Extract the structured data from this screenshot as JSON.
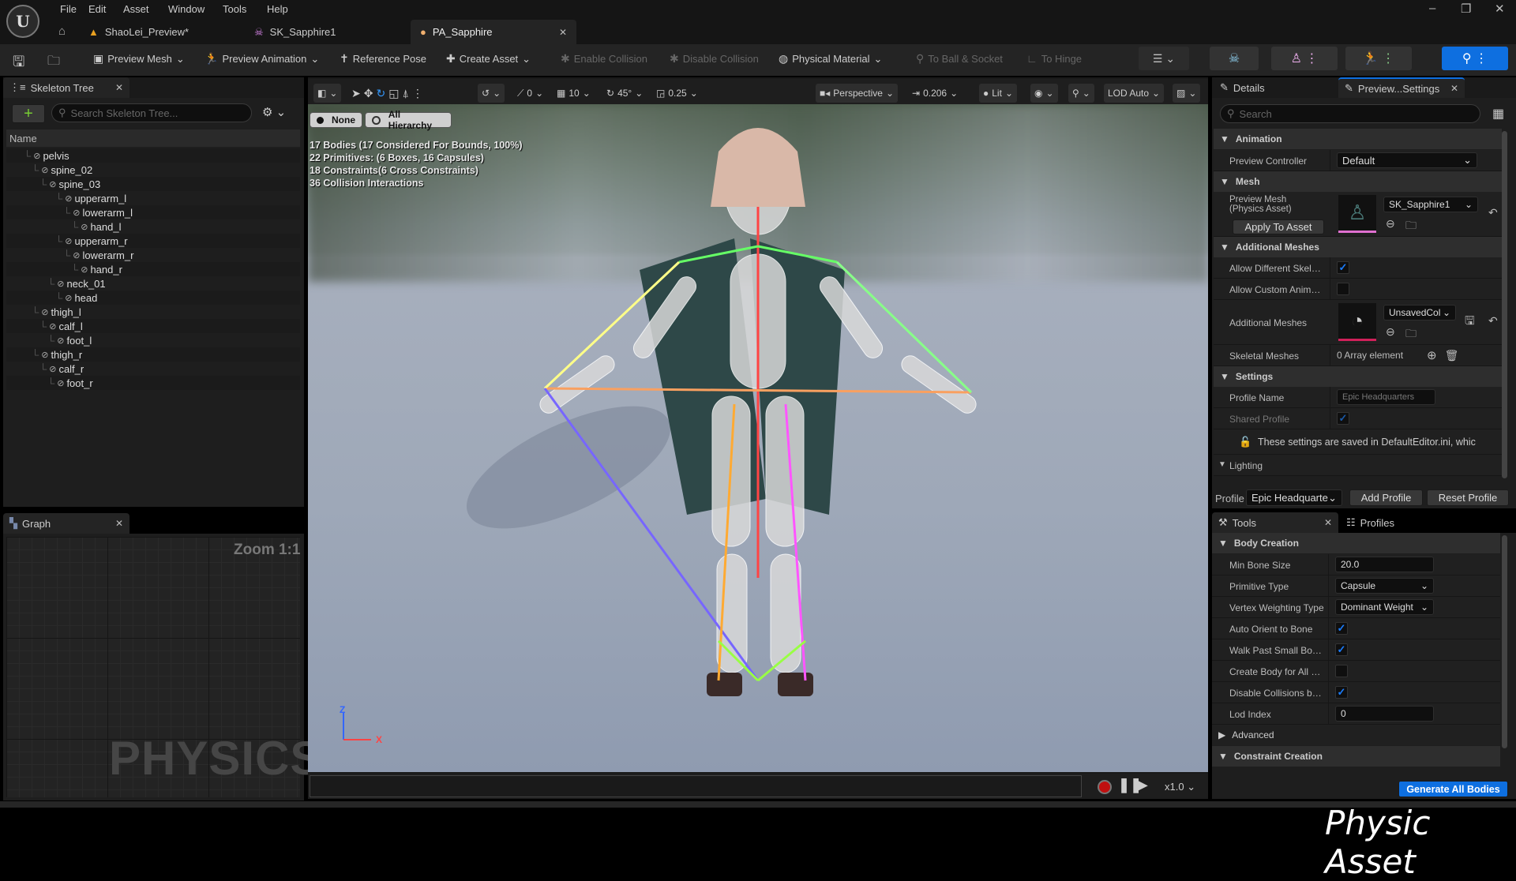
{
  "menu": [
    "File",
    "Edit",
    "Asset",
    "Window",
    "Tools",
    "Help"
  ],
  "doc_tabs": [
    {
      "label": "ShaoLei_Preview*",
      "icon": "level-icon"
    },
    {
      "label": "SK_Sapphire1",
      "icon": "skeleton-icon"
    },
    {
      "label": "PA_Sapphire",
      "icon": "physics-asset-icon",
      "active": true
    }
  ],
  "toolbar": {
    "preview_mesh": "Preview Mesh",
    "preview_animation": "Preview Animation",
    "reference_pose": "Reference Pose",
    "create_asset": "Create Asset",
    "enable_collision": "Enable Collision",
    "disable_collision": "Disable Collision",
    "physical_material": "Physical Material",
    "to_ball_socket": "To Ball & Socket",
    "to_hinge": "To Hinge"
  },
  "skeleton_tree": {
    "title": "Skeleton Tree",
    "search_placeholder": "Search Skeleton Tree...",
    "column": "Name",
    "bones": [
      {
        "name": "pelvis",
        "depth": 0
      },
      {
        "name": "spine_02",
        "depth": 1
      },
      {
        "name": "spine_03",
        "depth": 2
      },
      {
        "name": "upperarm_l",
        "depth": 4
      },
      {
        "name": "lowerarm_l",
        "depth": 5
      },
      {
        "name": "hand_l",
        "depth": 6
      },
      {
        "name": "upperarm_r",
        "depth": 4
      },
      {
        "name": "lowerarm_r",
        "depth": 5
      },
      {
        "name": "hand_r",
        "depth": 6
      },
      {
        "name": "neck_01",
        "depth": 3
      },
      {
        "name": "head",
        "depth": 4
      },
      {
        "name": "thigh_l",
        "depth": 1
      },
      {
        "name": "calf_l",
        "depth": 2
      },
      {
        "name": "foot_l",
        "depth": 3
      },
      {
        "name": "thigh_r",
        "depth": 1
      },
      {
        "name": "calf_r",
        "depth": 2
      },
      {
        "name": "foot_r",
        "depth": 3
      }
    ]
  },
  "graph": {
    "title": "Graph",
    "zoom": "Zoom 1:1",
    "watermark": "PHYSICS"
  },
  "viewport": {
    "snap_rotation": "0",
    "grid": "10",
    "angle": "45°",
    "scale": "0.25",
    "view": "Perspective",
    "speed": "0.206",
    "lit": "Lit",
    "lod": "LOD Auto",
    "selection": {
      "none": "None",
      "all": "All Hierarchy"
    },
    "stats": [
      "17 Bodies (17 Considered For Bounds, 100%)",
      "22 Primitives: (6 Boxes, 16 Capsules)",
      "18 Constraints(6 Cross Constraints)",
      "36 Collision Interactions"
    ],
    "axis": {
      "z": "Z",
      "x": "X"
    },
    "playback_speed": "x1.0"
  },
  "details": {
    "tab_details": "Details",
    "tab_preview": "Preview...Settings",
    "search_placeholder": "Search",
    "animation": "Animation",
    "preview_controller_label": "Preview Controller",
    "preview_controller": "Default",
    "mesh": "Mesh",
    "preview_mesh_label": "Preview Mesh\n(Physics Asset)",
    "preview_mesh": "SK_Sapphire1",
    "apply_to_asset": "Apply To Asset",
    "additional_meshes": "Additional Meshes",
    "allow_different_skeleton": "Allow Different Skeleton",
    "allow_custom_animbp": "Allow Custom AnimBP O",
    "additional_meshes_label": "Additional Meshes",
    "additional_meshes_value": "UnsavedCol",
    "skeletal_meshes": "Skeletal Meshes",
    "skeletal_meshes_value": "0 Array element",
    "settings": "Settings",
    "profile_name_label": "Profile Name",
    "profile_name": "Epic Headquarters",
    "shared_profile": "Shared Profile",
    "note": "These settings are saved in DefaultEditor.ini, whic",
    "lighting": "Lighting",
    "profile_label": "Profile",
    "profile_value": "Epic Headquarte",
    "add_profile": "Add Profile",
    "reset_profile": "Reset Profile"
  },
  "tools": {
    "tab_tools": "Tools",
    "tab_profiles": "Profiles",
    "body_creation": "Body Creation",
    "rows": [
      {
        "label": "Min Bone Size",
        "type": "input",
        "value": "20.0"
      },
      {
        "label": "Primitive Type",
        "type": "select",
        "value": "Capsule"
      },
      {
        "label": "Vertex Weighting Type",
        "type": "select",
        "value": "Dominant Weight"
      },
      {
        "label": "Auto Orient to Bone",
        "type": "check",
        "checked": true
      },
      {
        "label": "Walk Past Small Bones",
        "type": "check",
        "checked": true
      },
      {
        "label": "Create Body for All Bo...",
        "type": "check",
        "checked": false
      },
      {
        "label": "Disable Collisions by D...",
        "type": "check",
        "checked": true
      },
      {
        "label": "Lod Index",
        "type": "input",
        "value": "0"
      }
    ],
    "advanced": "Advanced",
    "constraint_creation": "Constraint Creation",
    "generate": "Generate All Bodies"
  },
  "caption": "Physic Asset",
  "colors": {
    "accent": "#0e6fe0",
    "record": "#c01010",
    "checkmark": "#1a7dff"
  }
}
